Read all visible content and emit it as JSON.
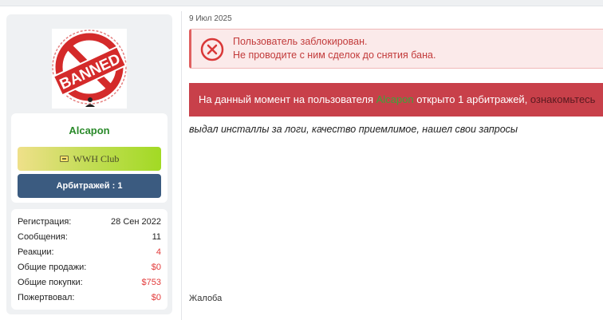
{
  "user": {
    "avatar_badge_text": "BANNED",
    "username": "Alcapon",
    "club_badge": "WWH Club",
    "arbitrations_button": "Арбитражей : 1"
  },
  "stats": [
    {
      "label": "Регистрация:",
      "value": "28 Сен 2022",
      "color": "#222222"
    },
    {
      "label": "Сообщения:",
      "value": "11",
      "color": "#222222"
    },
    {
      "label": "Реакции:",
      "value": "4",
      "color": "#e23a3a"
    },
    {
      "label": "Общие продажи:",
      "value": "$0",
      "color": "#e23a3a"
    },
    {
      "label": "Общие покупки:",
      "value": "$753",
      "color": "#e23a3a"
    },
    {
      "label": "Пожертвовал:",
      "value": "$0",
      "color": "#e23a3a"
    }
  ],
  "post": {
    "date": "9 Июл 2025",
    "ban_notice": {
      "line1": "Пользователь заблокирован.",
      "line2": "Не проводите с ним сделок до снятия бана."
    },
    "arbitration_notice": {
      "prefix": "На данный момент на пользователя ",
      "user": "Alcapon",
      "middle": " открыто 1 арбитражей, ",
      "link": "ознакомьтесь"
    },
    "body": "выдал инсталлы за логи, качество приемлимое, нашел свои запросы",
    "report_link": "Жалоба"
  },
  "colors": {
    "username": "#2a8a2a",
    "arbitration_bg": "#c8404a",
    "ban_bg": "#fbeaea",
    "ban_text": "#c23a3a",
    "button_blue": "#3b5b80"
  }
}
